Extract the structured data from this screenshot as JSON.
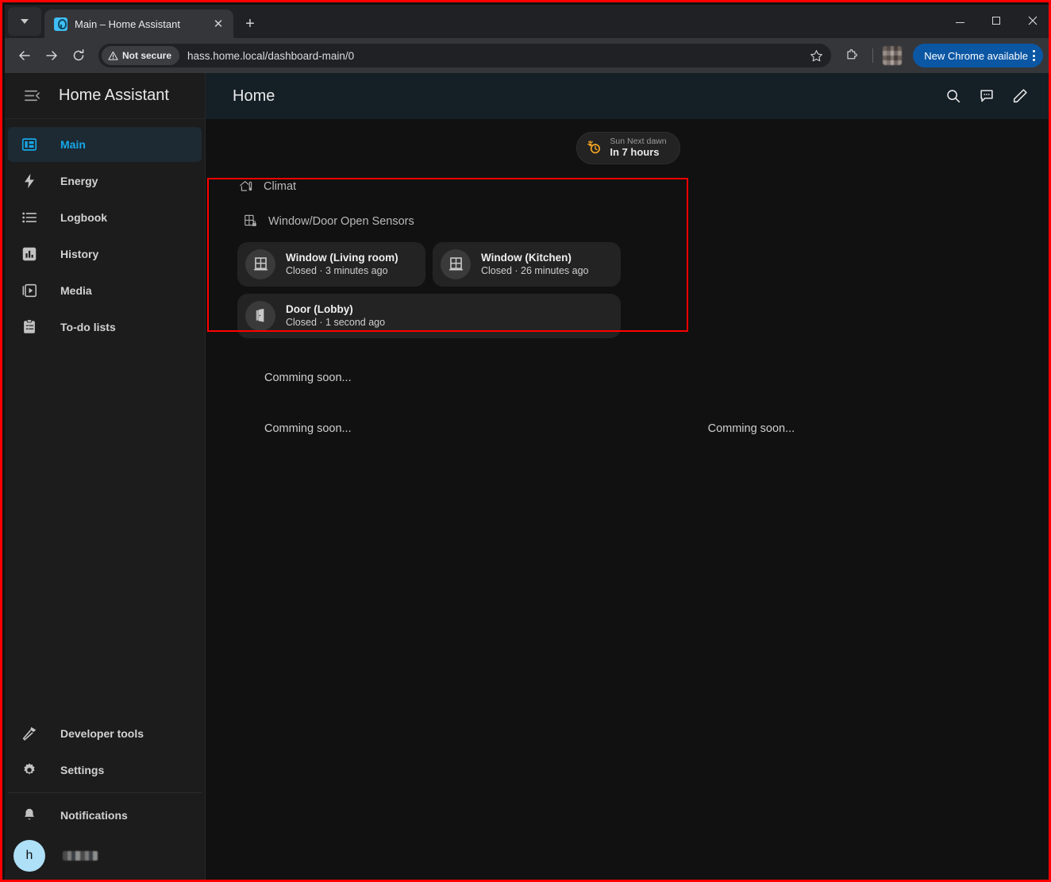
{
  "browser": {
    "tab": {
      "title": "Main – Home Assistant",
      "favicon_icon": "home-assistant-favicon",
      "close_icon": "close-icon"
    },
    "tab_list_icon": "chevron-down-icon",
    "new_tab_label": "+",
    "window_controls": {
      "minimize": "minimize-icon",
      "maximize": "maximize-icon",
      "close": "close-icon"
    },
    "nav": {
      "back_icon": "arrow-back-icon",
      "forward_icon": "arrow-forward-icon",
      "reload_icon": "reload-icon"
    },
    "omnibox": {
      "security_label": "Not secure",
      "security_icon": "warning-triangle-icon",
      "url": "hass.home.local/dashboard-main/0",
      "bookmark_icon": "star-icon"
    },
    "extensions_icon": "puzzle-piece-icon",
    "profile_avatar": "profile-avatar-blurred",
    "update_button": {
      "label": "New Chrome available",
      "menu_icon": "kebab-menu-icon"
    }
  },
  "sidebar": {
    "toggle_icon": "menu-collapse-icon",
    "title": "Home Assistant",
    "items": [
      {
        "label": "Main",
        "icon": "view-dashboard-icon",
        "active": true
      },
      {
        "label": "Energy",
        "icon": "lightning-bolt-icon",
        "active": false
      },
      {
        "label": "Logbook",
        "icon": "format-list-icon",
        "active": false
      },
      {
        "label": "History",
        "icon": "chart-box-icon",
        "active": false
      },
      {
        "label": "Media",
        "icon": "play-box-icon",
        "active": false
      },
      {
        "label": "To-do lists",
        "icon": "clipboard-list-icon",
        "active": false
      }
    ],
    "bottom_items": [
      {
        "label": "Developer tools",
        "icon": "hammer-icon"
      },
      {
        "label": "Settings",
        "icon": "gear-icon"
      }
    ],
    "notifications": {
      "label": "Notifications",
      "icon": "bell-icon"
    },
    "user": {
      "avatar_initial": "h",
      "name": ""
    }
  },
  "view": {
    "title": "Home",
    "actions": [
      {
        "name": "search",
        "icon": "search-icon"
      },
      {
        "name": "assist",
        "icon": "assist-chat-icon"
      },
      {
        "name": "edit",
        "icon": "pencil-icon"
      }
    ],
    "badges": [
      {
        "name": "Sun Next dawn",
        "state": "In 7 hours",
        "icon": "sun-clock-icon",
        "color": "#f5a623"
      }
    ],
    "sections": [
      {
        "heading": "Climat",
        "icon": "home-thermometer-icon"
      },
      {
        "heading": "Window/Door Open Sensors",
        "icon": "door-window-lock-icon"
      }
    ],
    "sensor_tiles": [
      {
        "name": "Window (Living room)",
        "state": "Closed · 3 minutes ago",
        "icon": "window-closed-icon",
        "size": "half"
      },
      {
        "name": "Window (Kitchen)",
        "state": "Closed · 26 minutes ago",
        "icon": "window-closed-icon",
        "size": "half"
      },
      {
        "name": "Door (Lobby)",
        "state": "Closed · 1 second ago",
        "icon": "door-closed-icon",
        "size": "full"
      }
    ],
    "placeholders": [
      {
        "text": "Comming soon..."
      },
      {
        "text": "Comming soon..."
      },
      {
        "text": "Comming soon..."
      }
    ]
  },
  "colors": {
    "accent": "#17a7e8",
    "annotation": "#ff0000",
    "badge_icon": "#f5a623",
    "app_background": "#111111",
    "card_background": "#232323",
    "toolbar_background": "#151f26"
  }
}
